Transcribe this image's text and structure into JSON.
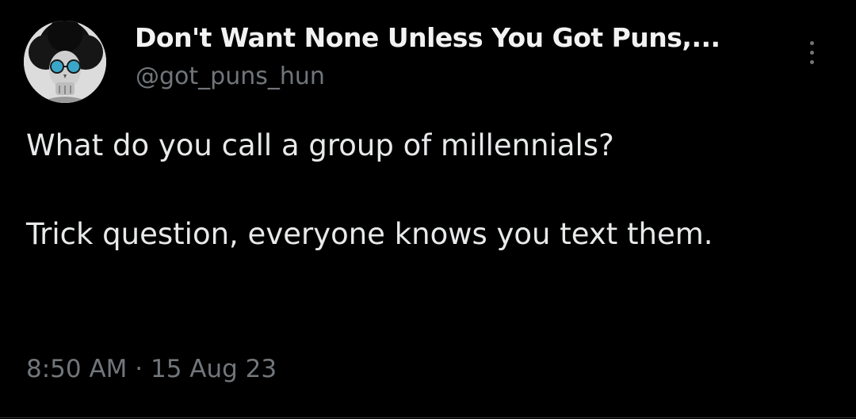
{
  "author": {
    "display_name": "Don't Want None Unless You Got Puns,...",
    "handle": "@got_puns_hun"
  },
  "tweet": {
    "line1": "What do you call a group of millennials?",
    "line2": "Trick question, everyone knows you text them.",
    "time": "8:50 AM",
    "separator": "·",
    "date": "15 Aug 23"
  },
  "icons": {
    "avatar": "skeleton-with-sunglasses-avatar",
    "more": "vertical-ellipsis-icon"
  },
  "colors": {
    "background": "#000000",
    "primary_text": "#e7e9ea",
    "secondary_text": "#71767b"
  }
}
